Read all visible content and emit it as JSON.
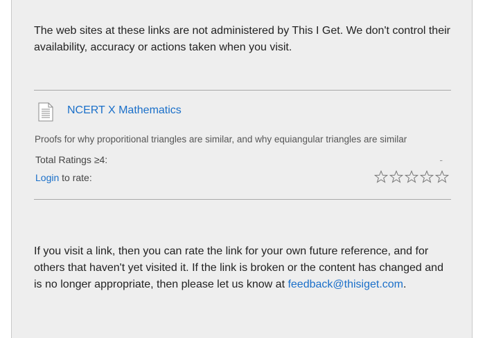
{
  "intro": {
    "text": "The web sites at these links are not administered by This I Get. We don't control their availability, accuracy or actions taken when you visit."
  },
  "link_item": {
    "icon": "document-icon",
    "title": "NCERT X Mathematics",
    "description": "Proofs for why proporitional triangles are similar, and why equiangular triangles are similar",
    "ratings_label": "Total Ratings ≥4:",
    "ratings_value": "-",
    "login_label": "Login",
    "rate_label": " to rate:",
    "star_icon": "star-outline-icon",
    "star_count": 5
  },
  "outro": {
    "text": "If you visit a link, then you can rate the link for your own future reference, and for others that haven't yet visited it. If the link is broken or the content has changed and is no longer appropriate, then please let us know at ",
    "email": "feedback@thisiget.com",
    "end": "."
  },
  "colors": {
    "panel_bg": "#eeeeee",
    "link": "#1a6fc9",
    "text": "#222222",
    "rule": "#a8a8a8"
  }
}
